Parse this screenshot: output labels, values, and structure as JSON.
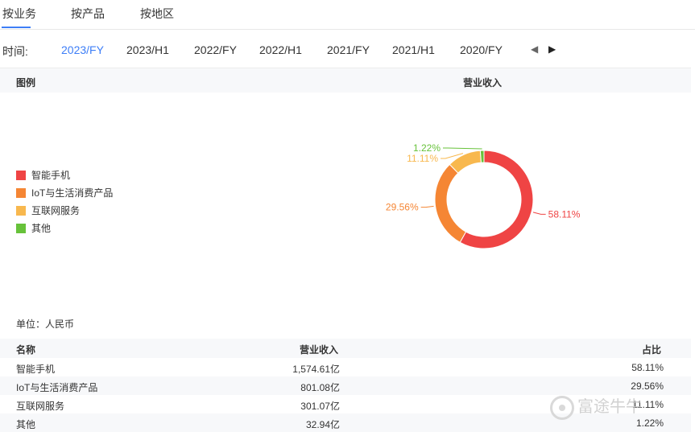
{
  "tabs": [
    {
      "label": "按业务",
      "active": true
    },
    {
      "label": "按产品",
      "active": false
    },
    {
      "label": "按地区",
      "active": false
    }
  ],
  "time": {
    "label": "时间:",
    "periods": [
      "2023/FY",
      "2023/H1",
      "2022/FY",
      "2022/H1",
      "2021/FY",
      "2021/H1",
      "2020/FY"
    ],
    "active_index": 0
  },
  "panel": {
    "legend_title": "图例",
    "chart_title": "营业收入"
  },
  "colors": {
    "accent": "#3d7ef7",
    "smartphone": "#ef4444",
    "iot": "#f58634",
    "internet": "#f8b84e",
    "other": "#67c23a"
  },
  "chart_data": {
    "type": "pie",
    "title": "营业收入",
    "donut": true,
    "legend_position": "left",
    "slices": [
      {
        "name": "智能手机",
        "value": 1574.61,
        "percent": 58.11,
        "label": "58.11%",
        "color": "#ef4444"
      },
      {
        "name": "IoT与生活消费产品",
        "value": 801.08,
        "percent": 29.56,
        "label": "29.56%",
        "color": "#f58634"
      },
      {
        "name": "互联网服务",
        "value": 301.07,
        "percent": 11.11,
        "label": "11.11%",
        "color": "#f8b84e"
      },
      {
        "name": "其他",
        "value": 32.94,
        "percent": 1.22,
        "label": "1.22%",
        "color": "#67c23a"
      }
    ]
  },
  "unit": "单位：人民币",
  "table": {
    "headers": {
      "name": "名称",
      "value": "营业收入",
      "pct": "占比"
    },
    "rows": [
      {
        "name": "智能手机",
        "value": "1,574.61亿",
        "pct": "58.11%"
      },
      {
        "name": "IoT与生活消费产品",
        "value": "801.08亿",
        "pct": "29.56%"
      },
      {
        "name": "互联网服务",
        "value": "301.07亿",
        "pct": "11.11%"
      },
      {
        "name": "其他",
        "value": "32.94亿",
        "pct": "1.22%"
      }
    ]
  },
  "watermark": "富途牛牛"
}
